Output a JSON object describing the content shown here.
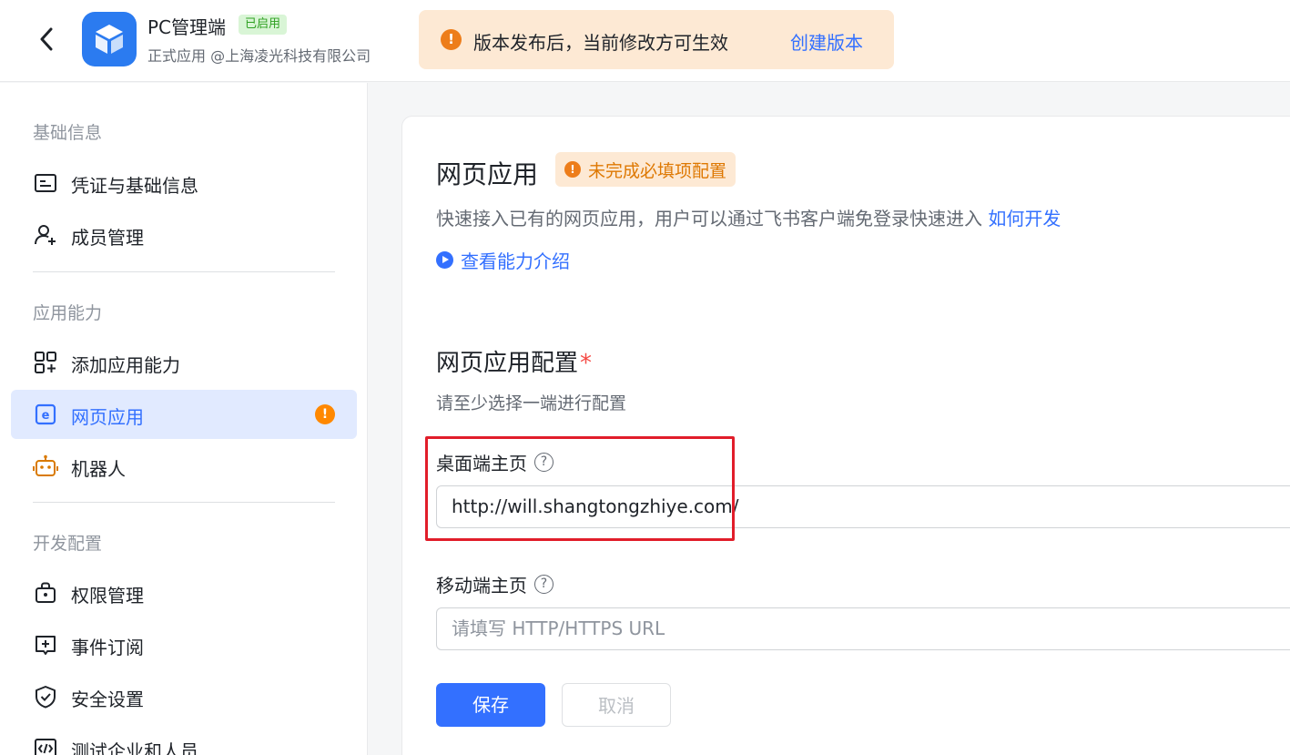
{
  "header": {
    "app_name": "PC管理端",
    "status_badge": "已启用",
    "subtitle": "正式应用 @上海凌光科技有限公司",
    "notice_text": "版本发布后，当前修改方可生效",
    "notice_link": "创建版本"
  },
  "sidebar": {
    "sections": [
      {
        "title": "基础信息",
        "items": [
          {
            "label": "凭证与基础信息",
            "icon": "id-card-icon"
          },
          {
            "label": "成员管理",
            "icon": "user-add-icon"
          }
        ]
      },
      {
        "title": "应用能力",
        "items": [
          {
            "label": "添加应用能力",
            "icon": "apps-add-icon"
          },
          {
            "label": "网页应用",
            "icon": "web-app-icon",
            "active": true,
            "warning": "!"
          },
          {
            "label": "机器人",
            "icon": "robot-icon"
          }
        ]
      },
      {
        "title": "开发配置",
        "items": [
          {
            "label": "权限管理",
            "icon": "lock-icon"
          },
          {
            "label": "事件订阅",
            "icon": "event-add-icon"
          },
          {
            "label": "安全设置",
            "icon": "shield-icon"
          },
          {
            "label": "测试企业和人员",
            "icon": "code-icon"
          }
        ]
      }
    ]
  },
  "main": {
    "title": "网页应用",
    "warn_badge": "未完成必填项配置",
    "description": "快速接入已有的网页应用，用户可以通过飞书客户端免登录快速进入",
    "description_link": "如何开发",
    "intro_link": "查看能力介绍",
    "config_title": "网页应用配置",
    "required_mark": "*",
    "config_hint": "请至少选择一端进行配置",
    "desktop_label": "桌面端主页",
    "desktop_value": "http://will.shangtongzhiye.com/",
    "mobile_label": "移动端主页",
    "mobile_placeholder": "请填写 HTTP/HTTPS URL",
    "help_glyph": "?",
    "save_label": "保存",
    "cancel_label": "取消"
  },
  "colors": {
    "accent": "#3370ff",
    "warning": "#ed7d1a",
    "highlight_box": "#e11d2a",
    "enabled_badge": "#2ea121"
  }
}
